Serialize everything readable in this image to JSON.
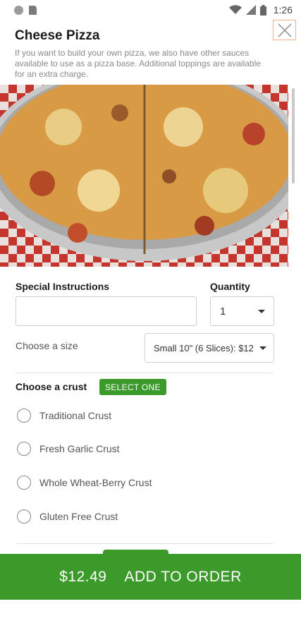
{
  "status": {
    "time": "1:26"
  },
  "header": {
    "title": "Cheese Pizza",
    "description": "If you want to build your own pizza, we also have other sauces available to use as a pizza base. Additional toppings are available for an extra charge."
  },
  "icons": {
    "circle": "circle-icon",
    "sd_card": "sd-card-icon",
    "wifi": "wifi-icon",
    "signal": "signal-icon",
    "battery": "battery-icon",
    "close": "close-icon",
    "caret": "caret-down-icon"
  },
  "colors": {
    "accent": "#3c9a2a",
    "badge": "#3a9a2a",
    "close_border": "#f0b48a"
  },
  "form": {
    "special_instructions_label": "Special Instructions",
    "special_instructions_value": "",
    "quantity_label": "Quantity",
    "quantity_value": "1",
    "size_label": "Choose a size",
    "size_value": "Small 10\" (6 Slices): $12"
  },
  "crust": {
    "label": "Choose a crust",
    "badge": "SELECT ONE",
    "options": [
      {
        "label": "Traditional Crust",
        "selected": false
      },
      {
        "label": "Fresh Garlic Crust",
        "selected": false
      },
      {
        "label": "Whole Wheat-Berry Crust",
        "selected": false
      },
      {
        "label": "Gluten Free Crust",
        "selected": false
      }
    ]
  },
  "cta": {
    "price": "$12.49",
    "label": "ADD TO ORDER"
  }
}
